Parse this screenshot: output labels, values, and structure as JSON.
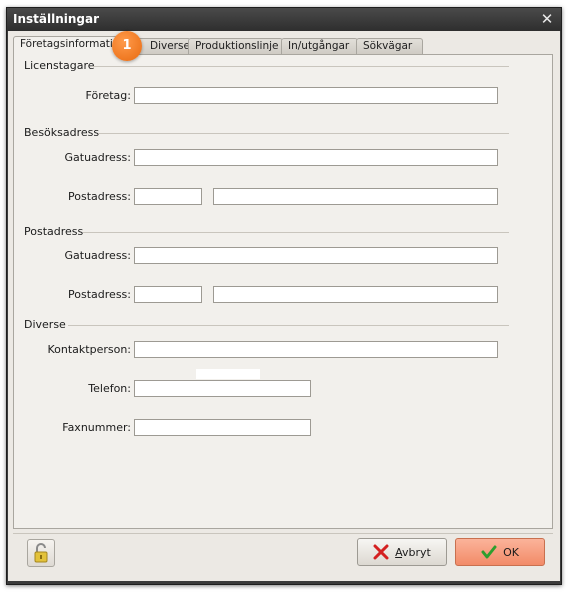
{
  "window": {
    "title": "Inställningar",
    "close_glyph": "✕"
  },
  "tabs": [
    {
      "label": "Företagsinformation"
    },
    {
      "label": "Diverse"
    },
    {
      "label": "Produktionslinje"
    },
    {
      "label": "In/utgångar"
    },
    {
      "label": "Sökvägar"
    }
  ],
  "badge": {
    "number": "1"
  },
  "groups": {
    "licensee": {
      "title": "Licenstagare",
      "company_label": "Företag:",
      "company_value": ""
    },
    "visit_address": {
      "title": "Besöksadress",
      "street_label": "Gatuadress:",
      "street_value": "",
      "postal_label": "Postadress:",
      "zip_value": "",
      "city_value": ""
    },
    "postal_address": {
      "title": "Postadress",
      "street_label": "Gatuadress:",
      "street_value": "",
      "postal_label": "Postadress:",
      "zip_value": "",
      "city_value": ""
    },
    "misc": {
      "title": "Diverse",
      "contact_label": "Kontaktperson:",
      "contact_value": "",
      "phone_label": "Telefon:",
      "phone_value": "",
      "fax_label": "Faxnummer:",
      "fax_value": ""
    }
  },
  "buttons": {
    "cancel": {
      "accel": "A",
      "rest": "vbryt",
      "icon": "cancel-x-icon"
    },
    "ok": {
      "label": "OK",
      "icon": "checkmark-icon"
    },
    "lock": {
      "icon": "unlocked-padlock-icon"
    }
  },
  "colors": {
    "ok_button": "#f28b68",
    "badge": "#e86a10",
    "cancel_icon": "#d42020",
    "ok_icon": "#2e9e2e"
  }
}
